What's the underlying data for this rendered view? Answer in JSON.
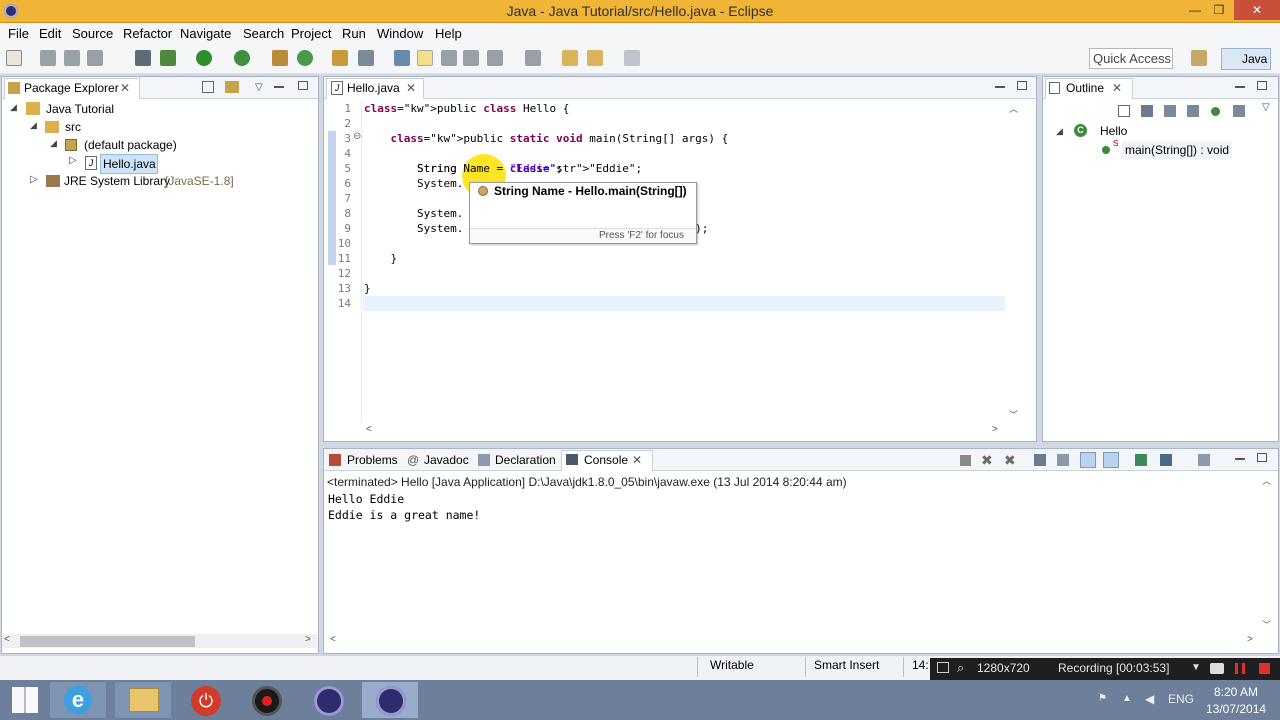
{
  "window": {
    "title": "Java - Java Tutorial/src/Hello.java - Eclipse",
    "min": "—",
    "max": "❐",
    "close": "✕"
  },
  "menu": [
    "File",
    "Edit",
    "Source",
    "Refactor",
    "Navigate",
    "Search",
    "Project",
    "Run",
    "Window",
    "Help"
  ],
  "toolbar": {
    "quick_access": "Quick Access",
    "perspective": "Java"
  },
  "package_explorer": {
    "tab": "Package Explorer",
    "items": [
      {
        "label": "Java Tutorial",
        "indent": 0,
        "expanded": true,
        "icon": "project-icon"
      },
      {
        "label": "src",
        "indent": 1,
        "expanded": true,
        "icon": "src-folder-icon"
      },
      {
        "label": "(default package)",
        "indent": 2,
        "expanded": true,
        "icon": "package-icon"
      },
      {
        "label": "Hello.java",
        "indent": 3,
        "expanded": false,
        "icon": "java-file-icon",
        "selected": true
      },
      {
        "label": "JRE System Library",
        "suffix": "[JavaSE-1.8]",
        "indent": 0,
        "expanded": false,
        "icon": "library-icon"
      }
    ]
  },
  "editor": {
    "tab": "Hello.java",
    "lines": [
      {
        "n": "1",
        "code": "public class Hello {"
      },
      {
        "n": "2",
        "code": ""
      },
      {
        "n": "3",
        "code": "    public static void main(String[] args) {"
      },
      {
        "n": "4",
        "code": ""
      },
      {
        "n": "5",
        "code": "        String Name = \"Eddie\";"
      },
      {
        "n": "6",
        "code": "        System."
      },
      {
        "n": "7",
        "code": ""
      },
      {
        "n": "8",
        "code": "        System."
      },
      {
        "n": "9",
        "code": "        System.                              ame!\");"
      },
      {
        "n": "10",
        "code": ""
      },
      {
        "n": "11",
        "code": "    }"
      },
      {
        "n": "12",
        "code": ""
      },
      {
        "n": "13",
        "code": "}"
      },
      {
        "n": "14",
        "code": ""
      }
    ],
    "tooltip": {
      "title": "String Name - Hello.main(String[])",
      "hint": "Press 'F2' for focus"
    }
  },
  "outline": {
    "tab": "Outline",
    "class_name": "Hello",
    "method": "main(String[]) : void",
    "static_marker": "S"
  },
  "bottom": {
    "tabs": [
      "Problems",
      "Javadoc",
      "Declaration",
      "Console"
    ],
    "status": "<terminated> Hello [Java Application] D:\\Java\\jdk1.8.0_05\\bin\\javaw.exe (13 Jul 2014 8:20:44 am)",
    "output": [
      "Hello Eddie",
      "Eddie is a great name!"
    ]
  },
  "statusbar": {
    "writable": "Writable",
    "insert": "Smart Insert",
    "pos": "14:"
  },
  "recorder": {
    "size": "1280x720",
    "recording": "Recording [00:03:53]"
  },
  "taskbar": {
    "lang": "ENG",
    "time": "8:20 AM",
    "date": "13/07/2014"
  }
}
